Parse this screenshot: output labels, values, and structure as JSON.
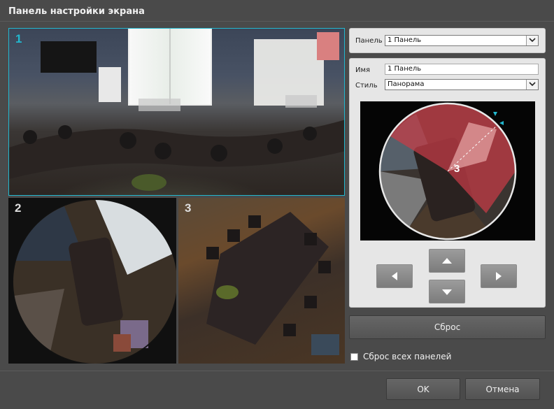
{
  "window": {
    "title": "Панель настройки экрана"
  },
  "panels": [
    {
      "number": "1"
    },
    {
      "number": "2"
    },
    {
      "number": "3"
    }
  ],
  "panel_select": {
    "label": "Панель",
    "value": "1 Панель"
  },
  "settings": {
    "name_label": "Имя",
    "name_value": "1 Панель",
    "style_label": "Стиль",
    "style_value": "Панорама",
    "preview_overlay_number": "3"
  },
  "reset_button": "Сброс",
  "reset_all": {
    "label": "Сброс всех панелей",
    "checked": false
  },
  "buttons": {
    "ok": "OK",
    "cancel": "Отмена"
  },
  "colors": {
    "accent": "#22b8cf",
    "selection_overlay": "#c83c46"
  }
}
